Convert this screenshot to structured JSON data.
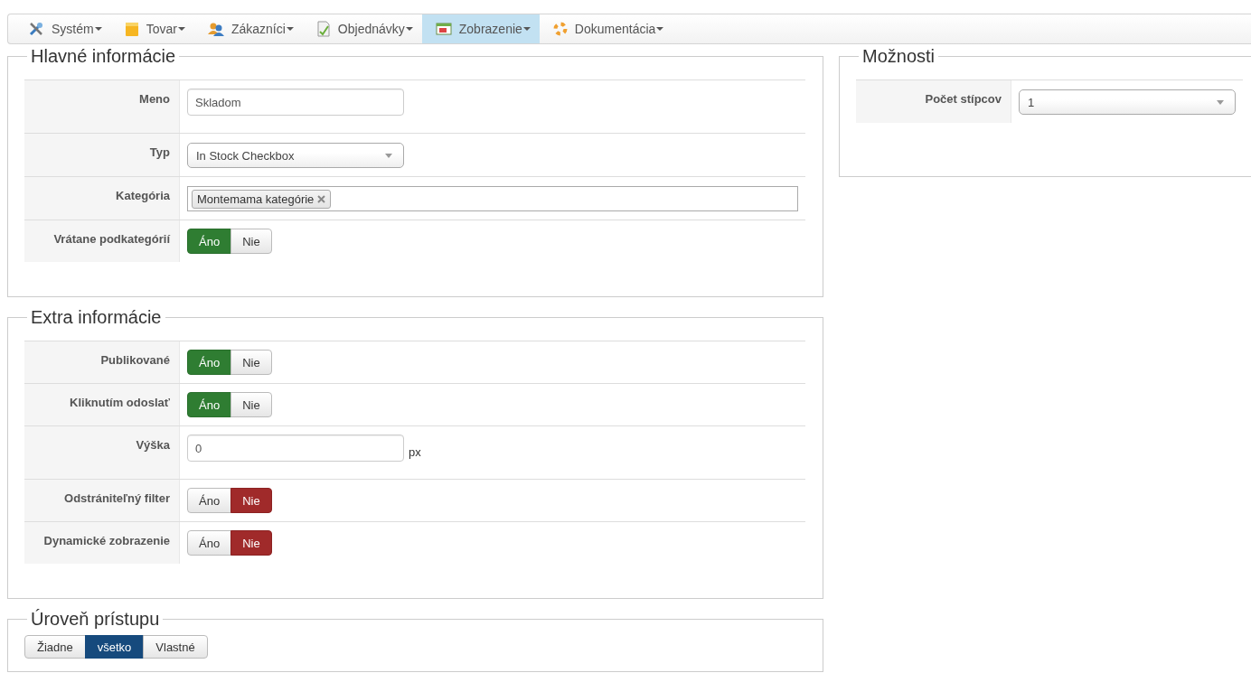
{
  "menu": [
    {
      "label": "Systém",
      "selected": false
    },
    {
      "label": "Tovar",
      "selected": false
    },
    {
      "label": "Zákazníci",
      "selected": false
    },
    {
      "label": "Objednávky",
      "selected": false
    },
    {
      "label": "Zobrazenie",
      "selected": true
    },
    {
      "label": "Dokumentácia",
      "selected": false
    }
  ],
  "columns": [
    {
      "panels": [
        {
          "title": "Hlavné informácie",
          "rows": [
            {
              "kind": "text",
              "label": "Meno",
              "value": "Skladom"
            },
            {
              "kind": "select",
              "label": "Typ",
              "value": "In Stock Checkbox"
            },
            {
              "kind": "tags",
              "label": "Kategória",
              "tags": [
                "Montemama kategórie"
              ]
            },
            {
              "kind": "toggle",
              "label": "Vrátane podkategórií",
              "options": [
                {
                  "label": "Áno",
                  "selected": true
                },
                {
                  "label": "Nie",
                  "selected": false
                }
              ]
            }
          ]
        },
        {
          "title": "Extra informácie",
          "rows": [
            {
              "kind": "toggle",
              "label": "Publikované",
              "options": [
                {
                  "label": "Áno",
                  "selected": true
                },
                {
                  "label": "Nie",
                  "selected": false
                }
              ]
            },
            {
              "kind": "toggle",
              "label": "Kliknutím odoslať",
              "options": [
                {
                  "label": "Áno",
                  "selected": true
                },
                {
                  "label": "Nie",
                  "selected": false
                }
              ]
            },
            {
              "kind": "text",
              "label": "Výška",
              "value": "0",
              "suffix": "px"
            },
            {
              "kind": "toggle",
              "label": "Odstrániteľný filter",
              "options": [
                {
                  "label": "Áno",
                  "selected": false
                },
                {
                  "label": "Nie",
                  "selected": true
                }
              ]
            },
            {
              "kind": "toggle",
              "label": "Dynamické zobrazenie",
              "options": [
                {
                  "label": "Áno",
                  "selected": false
                },
                {
                  "label": "Nie",
                  "selected": true
                }
              ]
            }
          ]
        },
        {
          "title": "Úroveň prístupu",
          "rows": [
            {
              "kind": "segmented",
              "options": [
                {
                  "label": "Žiadne",
                  "selected": false
                },
                {
                  "label": "všetko",
                  "selected": true
                },
                {
                  "label": "Vlastné",
                  "selected": false
                }
              ]
            }
          ]
        }
      ]
    },
    {
      "panels": [
        {
          "title": "Možnosti",
          "rows": [
            {
              "kind": "select",
              "label": "Počet stípcov",
              "value": "1"
            }
          ]
        }
      ]
    }
  ]
}
